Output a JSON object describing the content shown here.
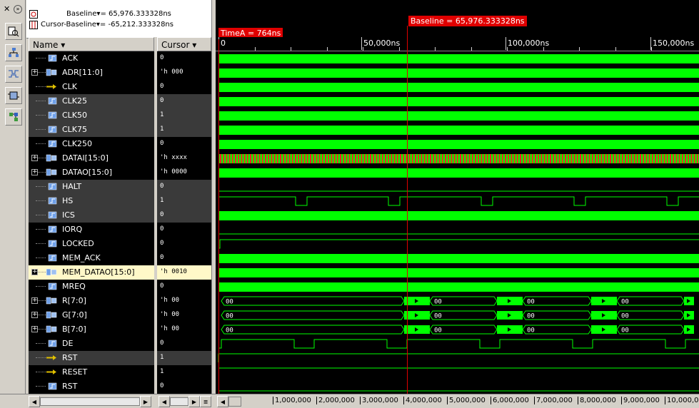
{
  "header": {
    "baseline_label": "Baseline",
    "baseline_value": "= 65,976.333328ns",
    "cursor_baseline_label": "Cursor-Baseline",
    "cursor_baseline_value": "= -65,212.333328ns"
  },
  "columns": {
    "name": "Name",
    "cursor": "Cursor"
  },
  "markers": {
    "baseline": "Baseline = 65,976.333328ns",
    "timea": "TimeA = 764ns"
  },
  "ruler_ticks": [
    "0",
    "50,000ns",
    "100,000ns",
    "150,000ns"
  ],
  "bottom_ticks": [
    "1,000,000",
    "2,000,000",
    "3,000,000",
    "4,000,000",
    "5,000,000",
    "6,000,000",
    "7,000,000",
    "8,000,000",
    "9,000,000",
    "10,000,00"
  ],
  "signals": [
    {
      "name": "ACK",
      "value": "0",
      "expand": false,
      "icon": "signal-icon"
    },
    {
      "name": "ADR[11:0]",
      "value": "'h 000",
      "expand": true,
      "icon": "bus-icon"
    },
    {
      "name": "CLK",
      "value": "0",
      "expand": false,
      "icon": "clock-arrow-icon"
    },
    {
      "name": "CLK25",
      "value": "0",
      "expand": false,
      "icon": "signal-icon"
    },
    {
      "name": "CLK50",
      "value": "1",
      "expand": false,
      "icon": "signal-icon"
    },
    {
      "name": "CLK75",
      "value": "1",
      "expand": false,
      "icon": "signal-icon"
    },
    {
      "name": "CLK250",
      "value": "0",
      "expand": false,
      "icon": "signal-icon"
    },
    {
      "name": "DATAI[15:0]",
      "value": "'h xxxx",
      "expand": true,
      "icon": "bus-icon"
    },
    {
      "name": "DATAO[15:0]",
      "value": "'h 0000",
      "expand": true,
      "icon": "bus-icon"
    },
    {
      "name": "HALT",
      "value": "0",
      "expand": false,
      "icon": "signal-icon"
    },
    {
      "name": "HS",
      "value": "1",
      "expand": false,
      "icon": "signal-icon"
    },
    {
      "name": "ICS",
      "value": "0",
      "expand": false,
      "icon": "signal-icon"
    },
    {
      "name": "IORQ",
      "value": "0",
      "expand": false,
      "icon": "signal-icon"
    },
    {
      "name": "LOCKED",
      "value": "0",
      "expand": false,
      "icon": "signal-icon"
    },
    {
      "name": "MEM_ACK",
      "value": "0",
      "expand": false,
      "icon": "signal-icon"
    },
    {
      "name": "MEM_DATAO[15:0]",
      "value": "'h 0010",
      "expand": true,
      "icon": "bus-icon",
      "selected": true
    },
    {
      "name": "MREQ",
      "value": "0",
      "expand": false,
      "icon": "signal-icon"
    },
    {
      "name": "R[7:0]",
      "value": "'h 00",
      "expand": true,
      "icon": "bus-icon"
    },
    {
      "name": "G[7:0]",
      "value": "'h 00",
      "expand": true,
      "icon": "bus-icon"
    },
    {
      "name": "B[7:0]",
      "value": "'h 00",
      "expand": true,
      "icon": "bus-icon"
    },
    {
      "name": "DE",
      "value": "0",
      "expand": false,
      "icon": "signal-icon"
    },
    {
      "name": "RST",
      "value": "1",
      "expand": false,
      "icon": "clock-arrow-icon"
    },
    {
      "name": "RESET",
      "value": "1",
      "expand": false,
      "icon": "clock-arrow-icon"
    },
    {
      "name": "RST",
      "value": "0",
      "expand": false,
      "icon": "signal-icon"
    }
  ],
  "bus_label": "00",
  "colors": {
    "wave_green": "#00ff00",
    "marker_red": "#e00000",
    "datai_red": "#ff2020",
    "highlight": "#fff8c8"
  }
}
